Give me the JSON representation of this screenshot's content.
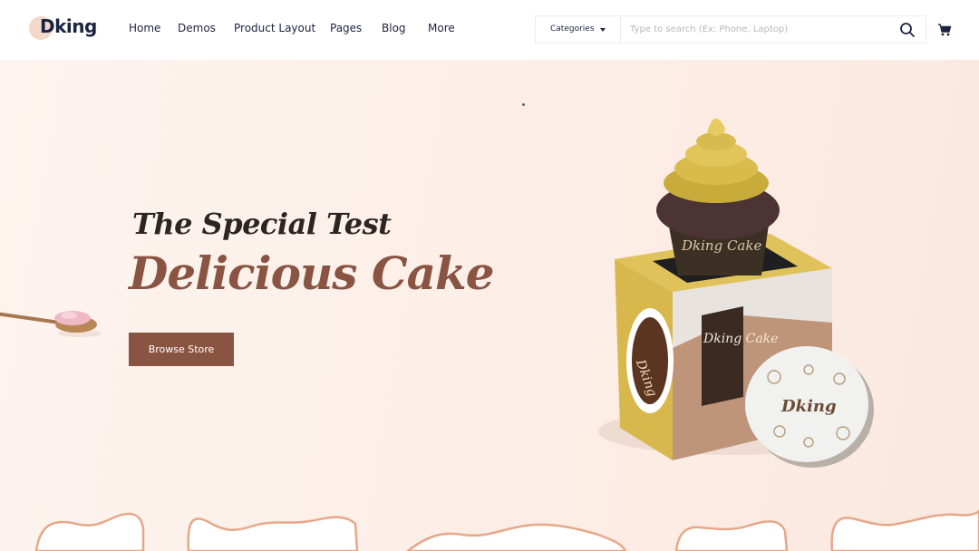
{
  "brand": {
    "name": "Dking"
  },
  "nav": {
    "items": [
      {
        "label": "Home"
      },
      {
        "label": "Demos"
      },
      {
        "label": "Product Layout"
      },
      {
        "label": "Pages"
      },
      {
        "label": "Blog"
      },
      {
        "label": "More"
      }
    ]
  },
  "search": {
    "category_label": "Categories",
    "placeholder": "Type to search (Ex: Phone, Laptop)"
  },
  "icons": {
    "search": "search-icon",
    "cart": "cart-icon",
    "caret": "chevron-down-icon"
  },
  "hero": {
    "subtitle": "The Special Test",
    "title": "Delicious Cake",
    "button_label": "Browse Store",
    "product_lid_label": "Dking",
    "product_cup_label": "Dking Cake",
    "product_box_label": "Dking Cake",
    "product_circle_label": "Dking"
  },
  "colors": {
    "brand_dark": "#1c2340",
    "accent": "#8a5442",
    "hero_bg": "#fcefe8",
    "box_yellow": "#d6b54a"
  }
}
